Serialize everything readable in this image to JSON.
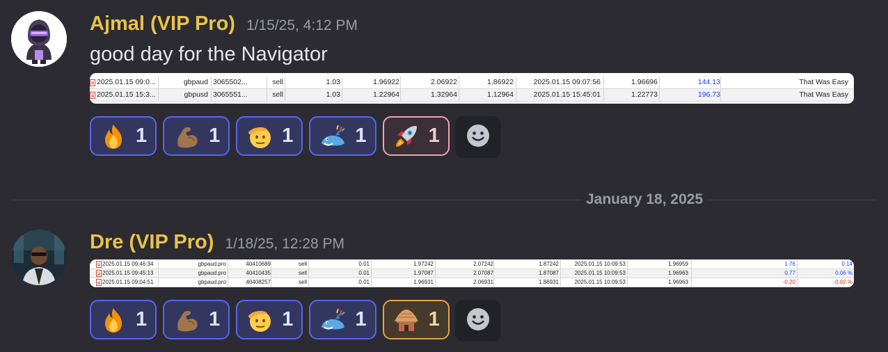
{
  "colors": {
    "background": "#2b2b31",
    "username": "#e9c24a",
    "timestamp": "#9a9ca4",
    "reaction_border": "#5865f2",
    "reaction_bg": "#333760"
  },
  "messages": [
    {
      "username": "Ajmal (VIP Pro)",
      "timestamp": "1/15/25, 4:12 PM",
      "text": "good day for the Navigator",
      "attachment_rows": [
        [
          "2025.01.15 09:0...",
          "gbpaud",
          "3065502...",
          "sell",
          "1.03",
          "1.96922",
          "2.06922",
          "1.86922",
          "2025.01.15 09:07:56",
          "1.96696",
          "144.13",
          "That Was Easy"
        ],
        [
          "2025.01.15 15:3...",
          "gbpusd",
          "3065551...",
          "sell",
          "1.03",
          "1.22964",
          "1.32964",
          "1.12964",
          "2025.01.15 15:45:01",
          "1.22773",
          "196.73",
          "That Was Easy"
        ]
      ],
      "reactions": [
        {
          "emoji": "fire-emoji",
          "count": "1"
        },
        {
          "emoji": "flexed-biceps-emoji",
          "count": "1"
        },
        {
          "emoji": "saluting-face-emoji",
          "count": "1"
        },
        {
          "emoji": "celebrating-dragon-emoji",
          "count": "1"
        },
        {
          "emoji": "rocket-emoji",
          "count": "1"
        }
      ],
      "add_reaction": "smiley-add-icon"
    },
    {
      "username": "Dre (VIP Pro)",
      "timestamp": "1/18/25, 12:28 PM",
      "attachment_rows": [
        [
          "2025.01.15 09:46:34",
          "gbpaud.pro",
          "40410689",
          "sell",
          "0.01",
          "1.97242",
          "2.07242",
          "1.87242",
          "2025.01.15 10:09:53",
          "1.96959",
          "1.76",
          "0.14"
        ],
        [
          "2025.01.15 09:45:13",
          "gbpaud.pro",
          "40410435",
          "sell",
          "0.01",
          "1.97087",
          "2.07087",
          "1.87087",
          "2025.01.15 10:09:53",
          "1.96963",
          "0.77",
          "0.06 %"
        ],
        [
          "2025.01.15 09:04:51",
          "gbpaud.pro",
          "40408257",
          "sell",
          "0.01",
          "1.96931",
          "2.06931",
          "1.86931",
          "2025.01.15 10:09:53",
          "1.96963",
          "-0.20",
          "-0.02 %"
        ]
      ],
      "reactions": [
        {
          "emoji": "fire-emoji",
          "count": "1"
        },
        {
          "emoji": "flexed-biceps-emoji",
          "count": "1"
        },
        {
          "emoji": "saluting-face-emoji",
          "count": "1"
        },
        {
          "emoji": "celebrating-dragon-emoji",
          "count": "1"
        },
        {
          "emoji": "hut-emoji",
          "count": "1"
        }
      ],
      "add_reaction": "smiley-add-icon"
    }
  ],
  "date_divider": "January 18, 2025"
}
